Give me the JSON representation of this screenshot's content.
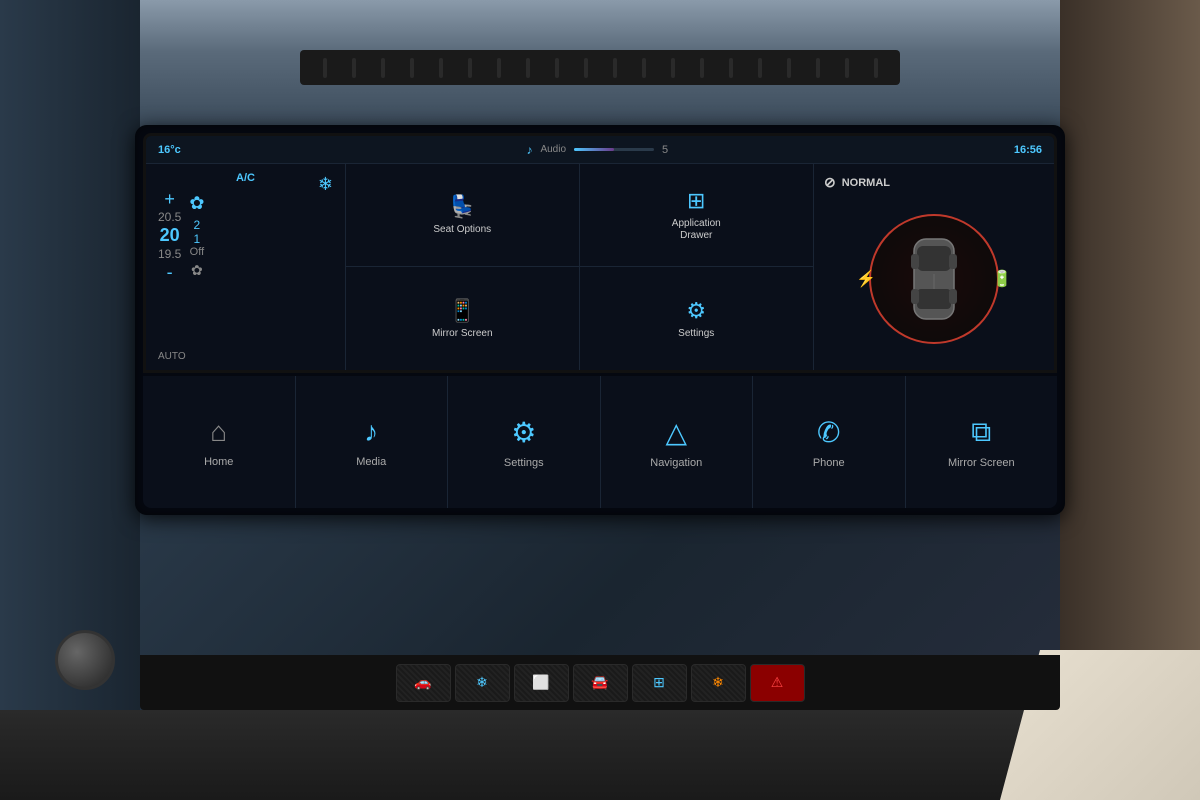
{
  "car": {
    "background_color": "#2a3a4a"
  },
  "upper_screen": {
    "status_bar": {
      "temperature": "16°c",
      "audio_label": "Audio",
      "audio_volume": "5",
      "time": "16:56"
    },
    "climate": {
      "ac_label": "A/C",
      "plus_label": "+",
      "minus_label": "-",
      "temp_upper": "20.5",
      "temp_current": "20",
      "temp_lower": "19.5",
      "fan_speed_2": "2",
      "fan_speed_1": "1",
      "fan_off": "Off",
      "auto_label": "AUTO"
    },
    "apps": [
      {
        "label": "Seat Options",
        "icon": "🪑"
      },
      {
        "label": "Application Drawer",
        "icon": "⊞"
      },
      {
        "label": "Mirror Screen",
        "icon": "📱"
      },
      {
        "label": "Settings",
        "icon": "⚙"
      }
    ],
    "vehicle": {
      "drive_mode": "NORMAL",
      "mode_icon": "⊘"
    }
  },
  "lower_screen": {
    "nav_items": [
      {
        "label": "Home",
        "icon": "⌂",
        "active": true
      },
      {
        "label": "Media",
        "icon": "♪",
        "active": false
      },
      {
        "label": "Settings",
        "icon": "⚙",
        "active": false
      },
      {
        "label": "Navigation",
        "icon": "△",
        "active": false
      },
      {
        "label": "Phone",
        "icon": "✆",
        "active": false
      },
      {
        "label": "Mirror Screen",
        "icon": "⧉",
        "active": false
      }
    ]
  },
  "physical_buttons": [
    {
      "icon": "🚗",
      "label": "car"
    },
    {
      "icon": "❄",
      "label": "ac"
    },
    {
      "icon": "🌡",
      "label": "defrost"
    },
    {
      "icon": "🚘",
      "label": "car2"
    },
    {
      "icon": "⊞",
      "label": "grid"
    },
    {
      "icon": "❄",
      "label": "ac-off"
    },
    {
      "icon": "⚠",
      "label": "hazard"
    }
  ]
}
